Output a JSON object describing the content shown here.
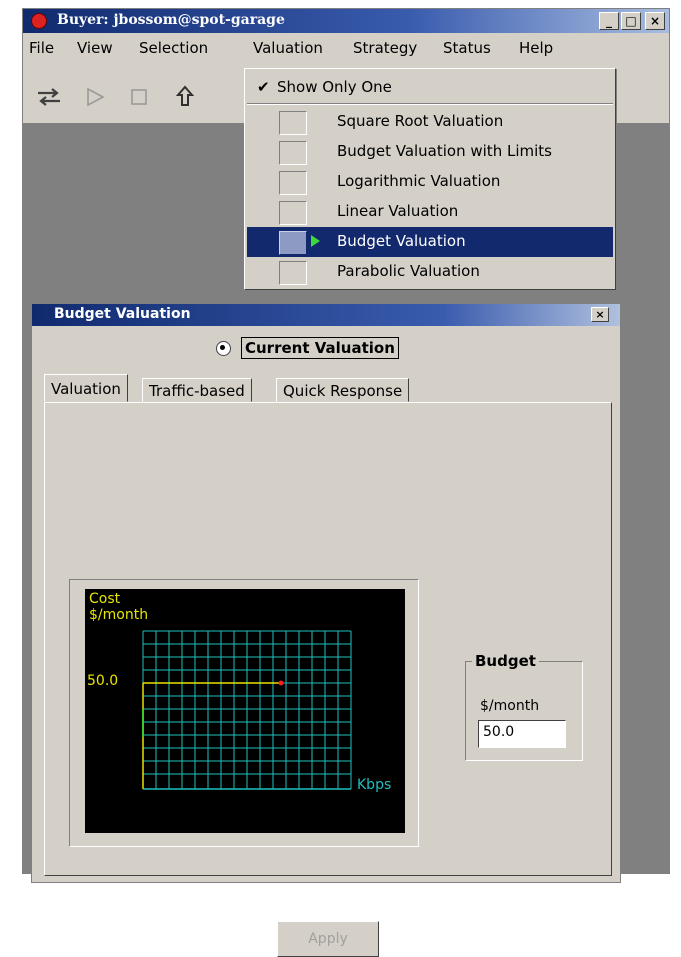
{
  "window": {
    "title": "Buyer: jbossom@spot-garage",
    "controls": [
      "_",
      "□",
      "×"
    ]
  },
  "menubar": [
    "File",
    "View",
    "Selection",
    "Valuation",
    "Strategy",
    "Status",
    "Help"
  ],
  "toolbar": {
    "icons": [
      "swap-arrows-icon",
      "play-icon",
      "stop-icon",
      "upload-icon"
    ]
  },
  "valuation_menu": {
    "show_only_one": {
      "label": "Show Only One",
      "checked": true,
      "check_glyph": "✔"
    },
    "items": [
      {
        "label": "Square Root Valuation",
        "selected": false
      },
      {
        "label": "Budget Valuation with Limits",
        "selected": false
      },
      {
        "label": "Logarithmic Valuation",
        "selected": false
      },
      {
        "label": "Linear Valuation",
        "selected": false
      },
      {
        "label": "Budget Valuation",
        "selected": true
      },
      {
        "label": "Parabolic Valuation",
        "selected": false
      }
    ]
  },
  "internal_frame": {
    "title": "Budget Valuation",
    "close": "×",
    "radio_label": "Current Valuation",
    "tabs": [
      "Valuation",
      "Traffic-based",
      "Quick Response"
    ],
    "active_tab": 0,
    "graph": {
      "y_label_line1": "Cost",
      "y_label_line2": "$/month",
      "x_label": "Kbps",
      "budget_marker": "50.0",
      "colors": {
        "background": "#000000",
        "grid": "#1fbfbf",
        "axis": "#e6e600",
        "text": "#e6e600",
        "xlabel": "#1fbfbf",
        "point": "#ff2020",
        "segment": "#30e030"
      }
    },
    "budget": {
      "legend": "Budget",
      "unit": "$/month",
      "value": "50.0"
    },
    "apply_label": "Apply"
  }
}
